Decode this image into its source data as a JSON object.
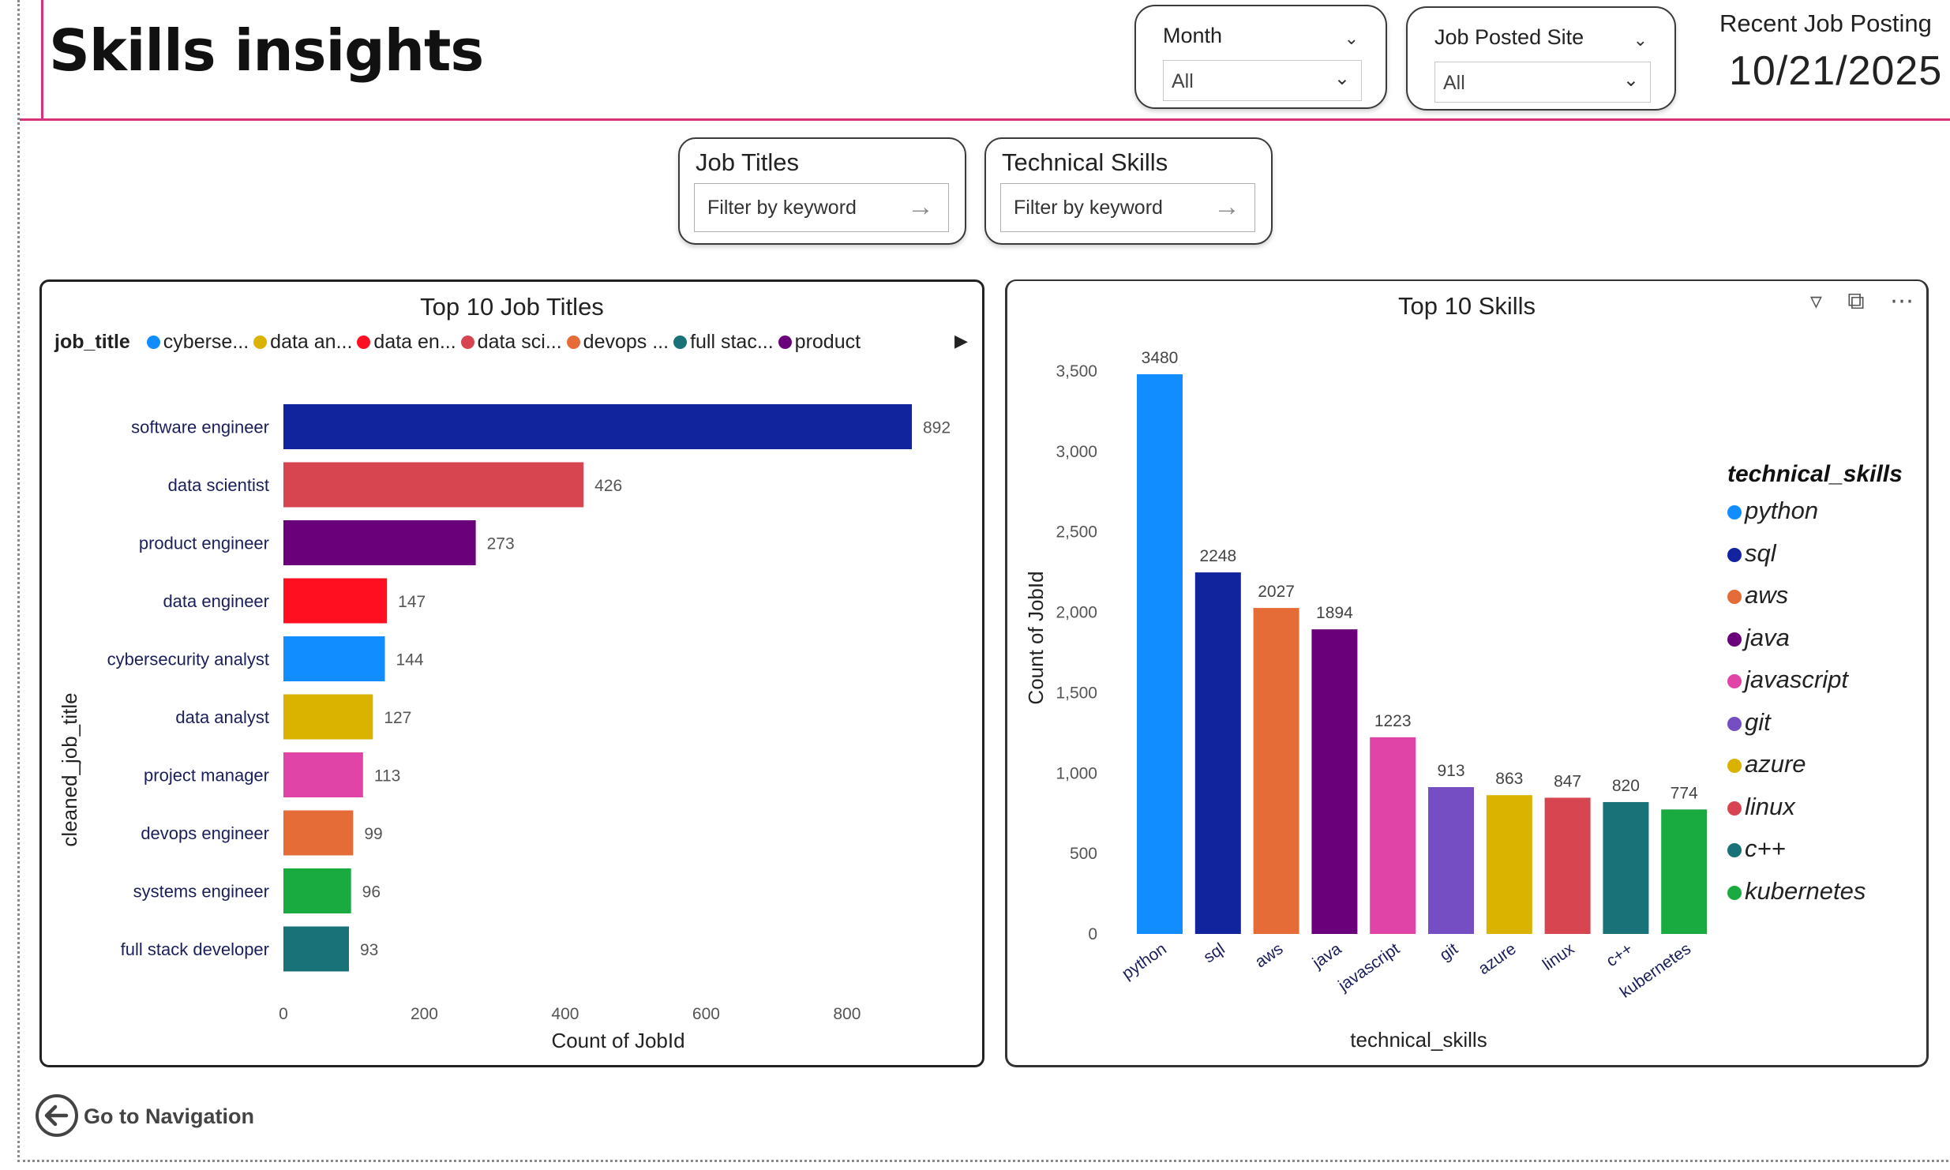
{
  "page": {
    "title": "Skills insights"
  },
  "slicers": {
    "month": {
      "label": "Month",
      "value": "All"
    },
    "site": {
      "label": "Job Posted Site",
      "value": "All"
    }
  },
  "recent": {
    "label": "Recent Job Posting",
    "date": "10/21/2025"
  },
  "filters": {
    "job_titles": {
      "label": "Job Titles",
      "placeholder": "Filter by keyword"
    },
    "skills": {
      "label": "Technical Skills",
      "placeholder": "Filter by keyword"
    }
  },
  "nav": {
    "label": "Go to Navigation"
  },
  "chart_data": [
    {
      "type": "bar",
      "orientation": "horizontal",
      "title": "Top 10 Job Titles",
      "xlabel": "Count of JobId",
      "ylabel": "cleaned_job_title",
      "xlim": [
        0,
        900
      ],
      "xticks": [
        0,
        200,
        400,
        600,
        800
      ],
      "grid": false,
      "legend": {
        "title": "job_title",
        "placement": "top",
        "entries": [
          {
            "label": "cyberse...",
            "color": "#118dff"
          },
          {
            "label": "data an...",
            "color": "#d9b300"
          },
          {
            "label": "data en...",
            "color": "#ff0f1f"
          },
          {
            "label": "data sci...",
            "color": "#d64550"
          },
          {
            "label": "devops ...",
            "color": "#e66c37"
          },
          {
            "label": "full stac...",
            "color": "#197278"
          },
          {
            "label": "product",
            "color": "#6b007b"
          }
        ]
      },
      "categories": [
        "software engineer",
        "data scientist",
        "product engineer",
        "data engineer",
        "cybersecurity analyst",
        "data analyst",
        "project manager",
        "devops engineer",
        "systems engineer",
        "full stack developer"
      ],
      "values": [
        892,
        426,
        273,
        147,
        144,
        127,
        113,
        99,
        96,
        93
      ],
      "colors": [
        "#12239e",
        "#d64550",
        "#6b007b",
        "#ff0f1f",
        "#118dff",
        "#d9b300",
        "#e044a7",
        "#e66c37",
        "#1aab40",
        "#197278"
      ]
    },
    {
      "type": "bar",
      "orientation": "vertical",
      "title": "Top 10 Skills",
      "xlabel": "technical_skills",
      "ylabel": "Count of JobId",
      "ylim": [
        0,
        3700
      ],
      "yticks": [
        0,
        500,
        1000,
        1500,
        2000,
        2500,
        3000,
        3500
      ],
      "grid": false,
      "legend": {
        "title": "technical_skills",
        "placement": "right"
      },
      "categories": [
        "python",
        "sql",
        "aws",
        "java",
        "javascript",
        "git",
        "azure",
        "linux",
        "c++",
        "kubernetes"
      ],
      "values": [
        3480,
        2248,
        2027,
        1894,
        1223,
        913,
        863,
        847,
        820,
        774
      ],
      "colors": [
        "#118dff",
        "#12239e",
        "#e66c37",
        "#6b007b",
        "#e044a7",
        "#744ec2",
        "#d9b300",
        "#d64550",
        "#197278",
        "#1aab40"
      ]
    }
  ]
}
